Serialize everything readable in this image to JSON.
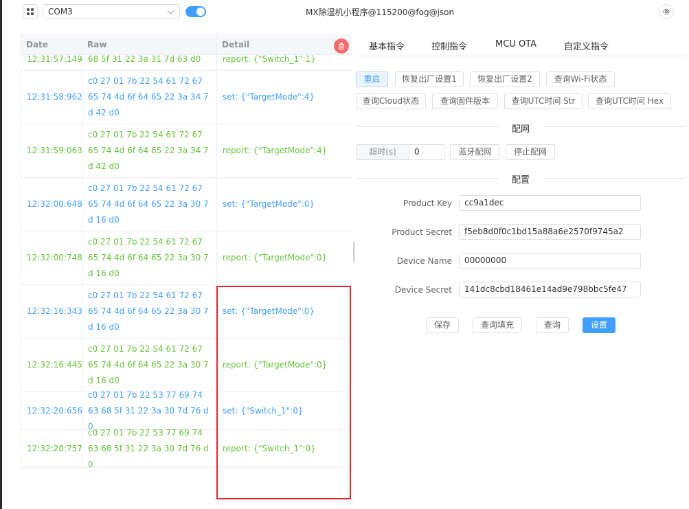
{
  "header": {
    "port": "COM3",
    "title": "MX除湿机小程序@115200@fog@json"
  },
  "log": {
    "columns": {
      "date": "Date",
      "raw": "Raw",
      "detail": "Detail"
    },
    "rows": [
      {
        "date": "12:31:57:149",
        "raw": "68 5f 31 22 3a 31 7d 63 d0",
        "detail": "report: {\"Switch_1\":1}",
        "dir": "rx"
      },
      {
        "date": "12:31:58:962",
        "raw": "c0 27 01 7b 22 54 61 72 67 65 74 4d 6f 64 65 22 3a 34 7d 42 d0",
        "detail": "set: {\"TargetMode\":4}",
        "dir": "tx"
      },
      {
        "date": "12:31:59:063",
        "raw": "c0 27 01 7b 22 54 61 72 67 65 74 4d 6f 64 65 22 3a 34 7d 42 d0",
        "detail": "report: {\"TargetMode\":4}",
        "dir": "rx"
      },
      {
        "date": "12:32:00:648",
        "raw": "c0 27 01 7b 22 54 61 72 67 65 74 4d 6f 64 65 22 3a 30 7d 16 d0",
        "detail": "set: {\"TargetMode\":0}",
        "dir": "tx"
      },
      {
        "date": "12:32:00:748",
        "raw": "c0 27 01 7b 22 54 61 72 67 65 74 4d 6f 64 65 22 3a 30 7d 16 d0",
        "detail": "report: {\"TargetMode\":0}",
        "dir": "rx"
      },
      {
        "date": "12:32:16:343",
        "raw": "c0 27 01 7b 22 54 61 72 67 65 74 4d 6f 64 65 22 3a 30 7d 16 d0",
        "detail": "set: {\"TargetMode\":0}",
        "dir": "tx"
      },
      {
        "date": "12:32:16:445",
        "raw": "c0 27 01 7b 22 54 61 72 67 65 74 4d 6f 64 65 22 3a 30 7d 16 d0",
        "detail": "report: {\"TargetMode\":0}",
        "dir": "rx"
      },
      {
        "date": "12:32:20:656",
        "raw": "c0 27 01 7b 22 53 77 69 74 63 68 5f 31 22 3a 30 7d 76 d0",
        "detail": "set: {\"Switch_1\":0}",
        "dir": "tx"
      },
      {
        "date": "12:32:20:757",
        "raw": "c0 27 01 7b 22 53 77 69 74 63 68 5f 31 22 3a 30 7d 76 d0",
        "detail": "report: {\"Switch_1\":0}",
        "dir": "rx"
      }
    ]
  },
  "tabs": [
    "基本指令",
    "控制指令",
    "MCU OTA",
    "自定义指令"
  ],
  "basic_commands": [
    "重启",
    "恢复出厂设置1",
    "恢复出厂设置2",
    "查询Wi-Fi状态",
    "查询Cloud状态",
    "查询固件版本",
    "查询UTC时间 Str",
    "查询UTC时间 Hex"
  ],
  "network": {
    "section_title": "配网",
    "timeout_label": "超时(s)",
    "timeout_value": "0",
    "bluetooth_btn": "蓝牙配网",
    "stop_btn": "停止配网"
  },
  "config": {
    "section_title": "配置",
    "product_key_label": "Product Key",
    "product_key": "cc9a1dec",
    "product_secret_label": "Product Secret",
    "product_secret": "f5eb8d0f0c1bd15a88a6e2570f9745a2",
    "device_name_label": "Device Name",
    "device_name": "00000000",
    "device_secret_label": "Device Secret",
    "device_secret": "141dc8cbd18461e14ad9e798bbc5fe47",
    "save_btn": "保存",
    "query_fill_btn": "查询填充",
    "query_btn": "查询",
    "set_btn": "设置"
  },
  "colors": {
    "tx": "#409eff",
    "rx": "#67c23a",
    "highlight": "#e8252b"
  }
}
